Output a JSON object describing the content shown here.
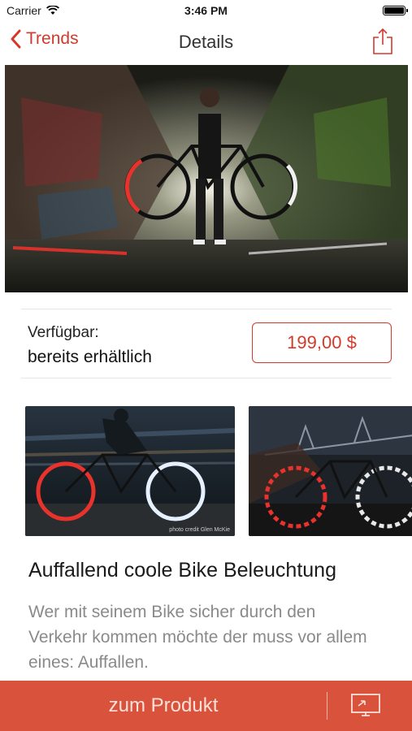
{
  "status_bar": {
    "carrier": "Carrier",
    "time": "3:46 PM"
  },
  "nav": {
    "back_label": "Trends",
    "title": "Details"
  },
  "availability": {
    "label": "Verfügbar:",
    "value": "bereits erhältlich",
    "price": "199,00 $"
  },
  "gallery": {
    "credit": "photo credit Glen McKie"
  },
  "article": {
    "title": "Auffallend coole Bike Beleuchtung",
    "body": "Wer mit seinem Bike sicher durch den Verkehr kommen möchte der muss vor allem eines: Auffallen."
  },
  "footer": {
    "product_label": "zum Produkt"
  },
  "colors": {
    "accent": "#d23a2c",
    "footer_bg": "#d9533c"
  }
}
